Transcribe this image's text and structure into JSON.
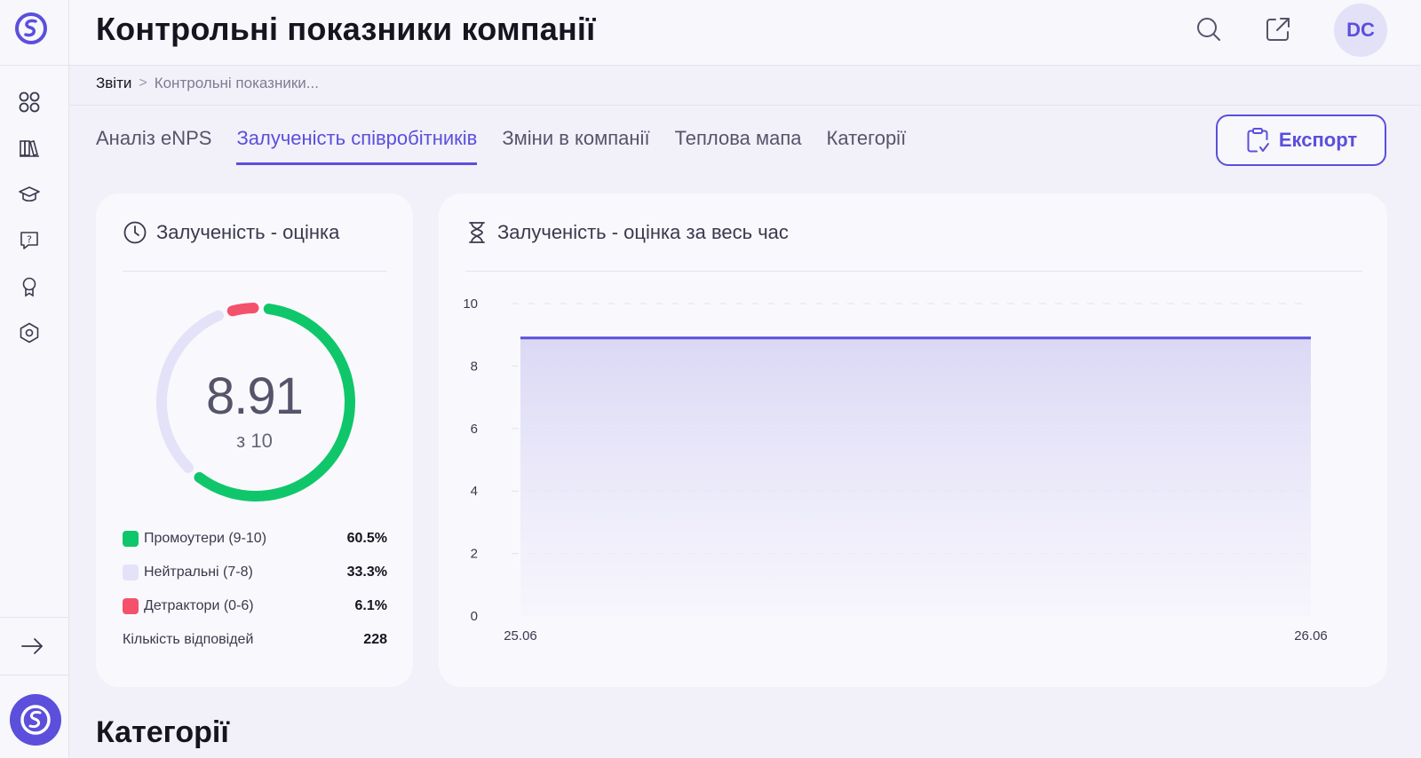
{
  "colors": {
    "accent": "#5b4fdc",
    "promoters": "#0fc76a",
    "neutrals": "#e3e2f8",
    "detractors": "#f4516c"
  },
  "sidebar": {
    "items": [
      {
        "icon": "dashboard-grid-icon"
      },
      {
        "icon": "library-books-icon"
      },
      {
        "icon": "graduation-cap-icon"
      },
      {
        "icon": "help-chat-icon"
      },
      {
        "icon": "award-ribbon-icon"
      },
      {
        "icon": "settings-hexagon-icon"
      }
    ],
    "expand_icon": "arrow-right-icon"
  },
  "header": {
    "title": "Контрольні показники компанії",
    "search_icon": "search-icon",
    "external_icon": "external-link-icon",
    "avatar": "DC"
  },
  "breadcrumb": {
    "root": "Звіти",
    "separator": ">",
    "current": "Контрольні показники..."
  },
  "tabs": [
    {
      "label": "Аналіз eNPS",
      "active": false
    },
    {
      "label": "Залученість співробітників",
      "active": true
    },
    {
      "label": "Зміни в компанії",
      "active": false
    },
    {
      "label": "Теплова мапа",
      "active": false
    },
    {
      "label": "Категорії",
      "active": false
    }
  ],
  "export": {
    "label": "Експорт"
  },
  "score_card": {
    "title": "Залученість - оцінка",
    "value": "8.91",
    "out_of": "з 10",
    "segments": [
      {
        "label": "Промоутери (9-10)",
        "value": "60.5%",
        "pct": 60.5
      },
      {
        "label": "Нейтральні (7-8)",
        "value": "33.3%",
        "pct": 33.3
      },
      {
        "label": "Детрактори (0-6)",
        "value": "6.1%",
        "pct": 6.1
      }
    ],
    "responses_label": "Кількість відповідей",
    "responses_value": "228"
  },
  "chart_card": {
    "title": "Залученість - оцінка за весь час"
  },
  "chart_data": {
    "type": "area",
    "title": "Залученість - оцінка за весь час",
    "x": [
      "25.06",
      "26.06"
    ],
    "series": [
      {
        "values": [
          8.9,
          8.9
        ]
      }
    ],
    "ylim": [
      0,
      10
    ],
    "yticks": [
      0,
      2,
      4,
      6,
      8,
      10
    ],
    "grid": true
  },
  "section": {
    "title": "Категорії"
  }
}
